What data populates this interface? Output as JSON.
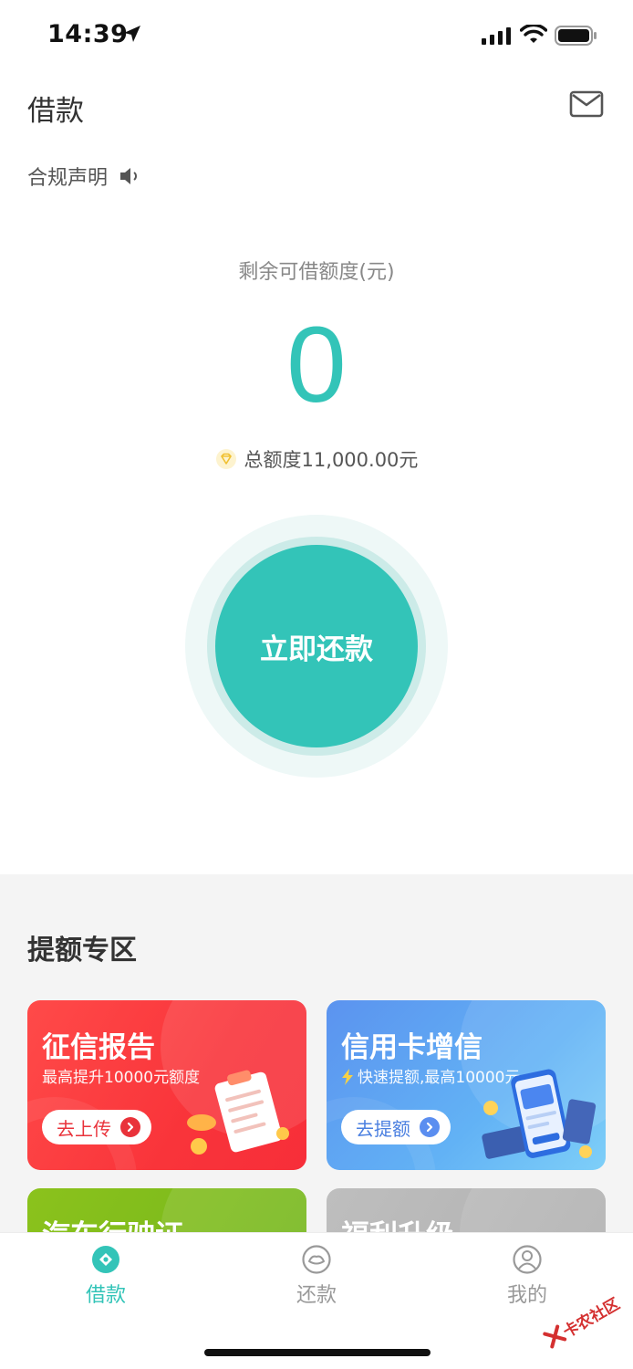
{
  "status_bar": {
    "time": "14:39"
  },
  "header": {
    "title": "借款"
  },
  "compliance": {
    "label": "合规声明"
  },
  "credit": {
    "label": "剩余可借额度(元)",
    "value": "0",
    "total": "总额度11,000.00元"
  },
  "repay_button": {
    "label": "立即还款"
  },
  "promo": {
    "title": "提额专区",
    "cards": [
      {
        "title": "征信报告",
        "subtitle": "最高提升10000元额度",
        "button": "去上传"
      },
      {
        "title": "信用卡增信",
        "subtitle": "快速提额,最高10000元",
        "button": "去提额"
      },
      {
        "title": "汽车行驶证"
      },
      {
        "title": "福利升级"
      }
    ]
  },
  "tab_bar": {
    "items": [
      {
        "label": "借款",
        "icon": "loan-icon",
        "active": true
      },
      {
        "label": "还款",
        "icon": "repay-icon",
        "active": false
      },
      {
        "label": "我的",
        "icon": "user-icon",
        "active": false
      }
    ]
  },
  "watermark": {
    "text": "卡农社区"
  },
  "colors": {
    "accent": "#33c4b8",
    "red_card": "#f9343a",
    "blue_card": "#5b93ef"
  }
}
